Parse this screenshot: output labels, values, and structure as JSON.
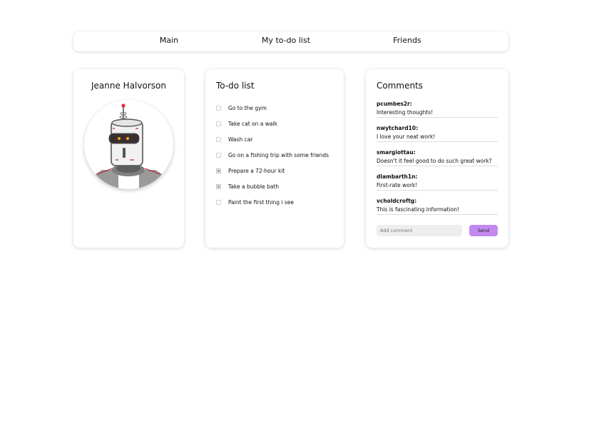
{
  "nav": {
    "tabs": [
      {
        "label": "Main"
      },
      {
        "label": "My to-do list"
      },
      {
        "label": "Friends"
      }
    ]
  },
  "profile": {
    "name": "Jeanne Halvorson",
    "avatar_icon": "robot-avatar-icon"
  },
  "todo": {
    "title": "To-do list",
    "items": [
      {
        "label": "Go to the gym",
        "checked": false
      },
      {
        "label": "Take cat on a walk",
        "checked": false
      },
      {
        "label": "Wash car",
        "checked": false
      },
      {
        "label": "Go on a fishing trip with some friends",
        "checked": false
      },
      {
        "label": "Prepare a 72-hour kit",
        "checked": true
      },
      {
        "label": "Take a bubble bath",
        "checked": true
      },
      {
        "label": "Paint the first thing i see",
        "checked": false
      }
    ]
  },
  "comments": {
    "title": "Comments",
    "items": [
      {
        "user": "pcumbes2r:",
        "text": "Interesting thoughts!"
      },
      {
        "user": "nwytchard10:",
        "text": "I love your neat work!"
      },
      {
        "user": "smargiottau:",
        "text": "Doesn't it feel good to do such great work?"
      },
      {
        "user": "dlambarth1n:",
        "text": "First-rate work!"
      },
      {
        "user": "vcholdcroftg:",
        "text": "This is fascinating information!"
      }
    ],
    "input_placeholder": "Add comment",
    "input_value": "",
    "send_label": "Send"
  },
  "colors": {
    "accent": "#c389ef",
    "robot_eye": "#f2a51a"
  }
}
